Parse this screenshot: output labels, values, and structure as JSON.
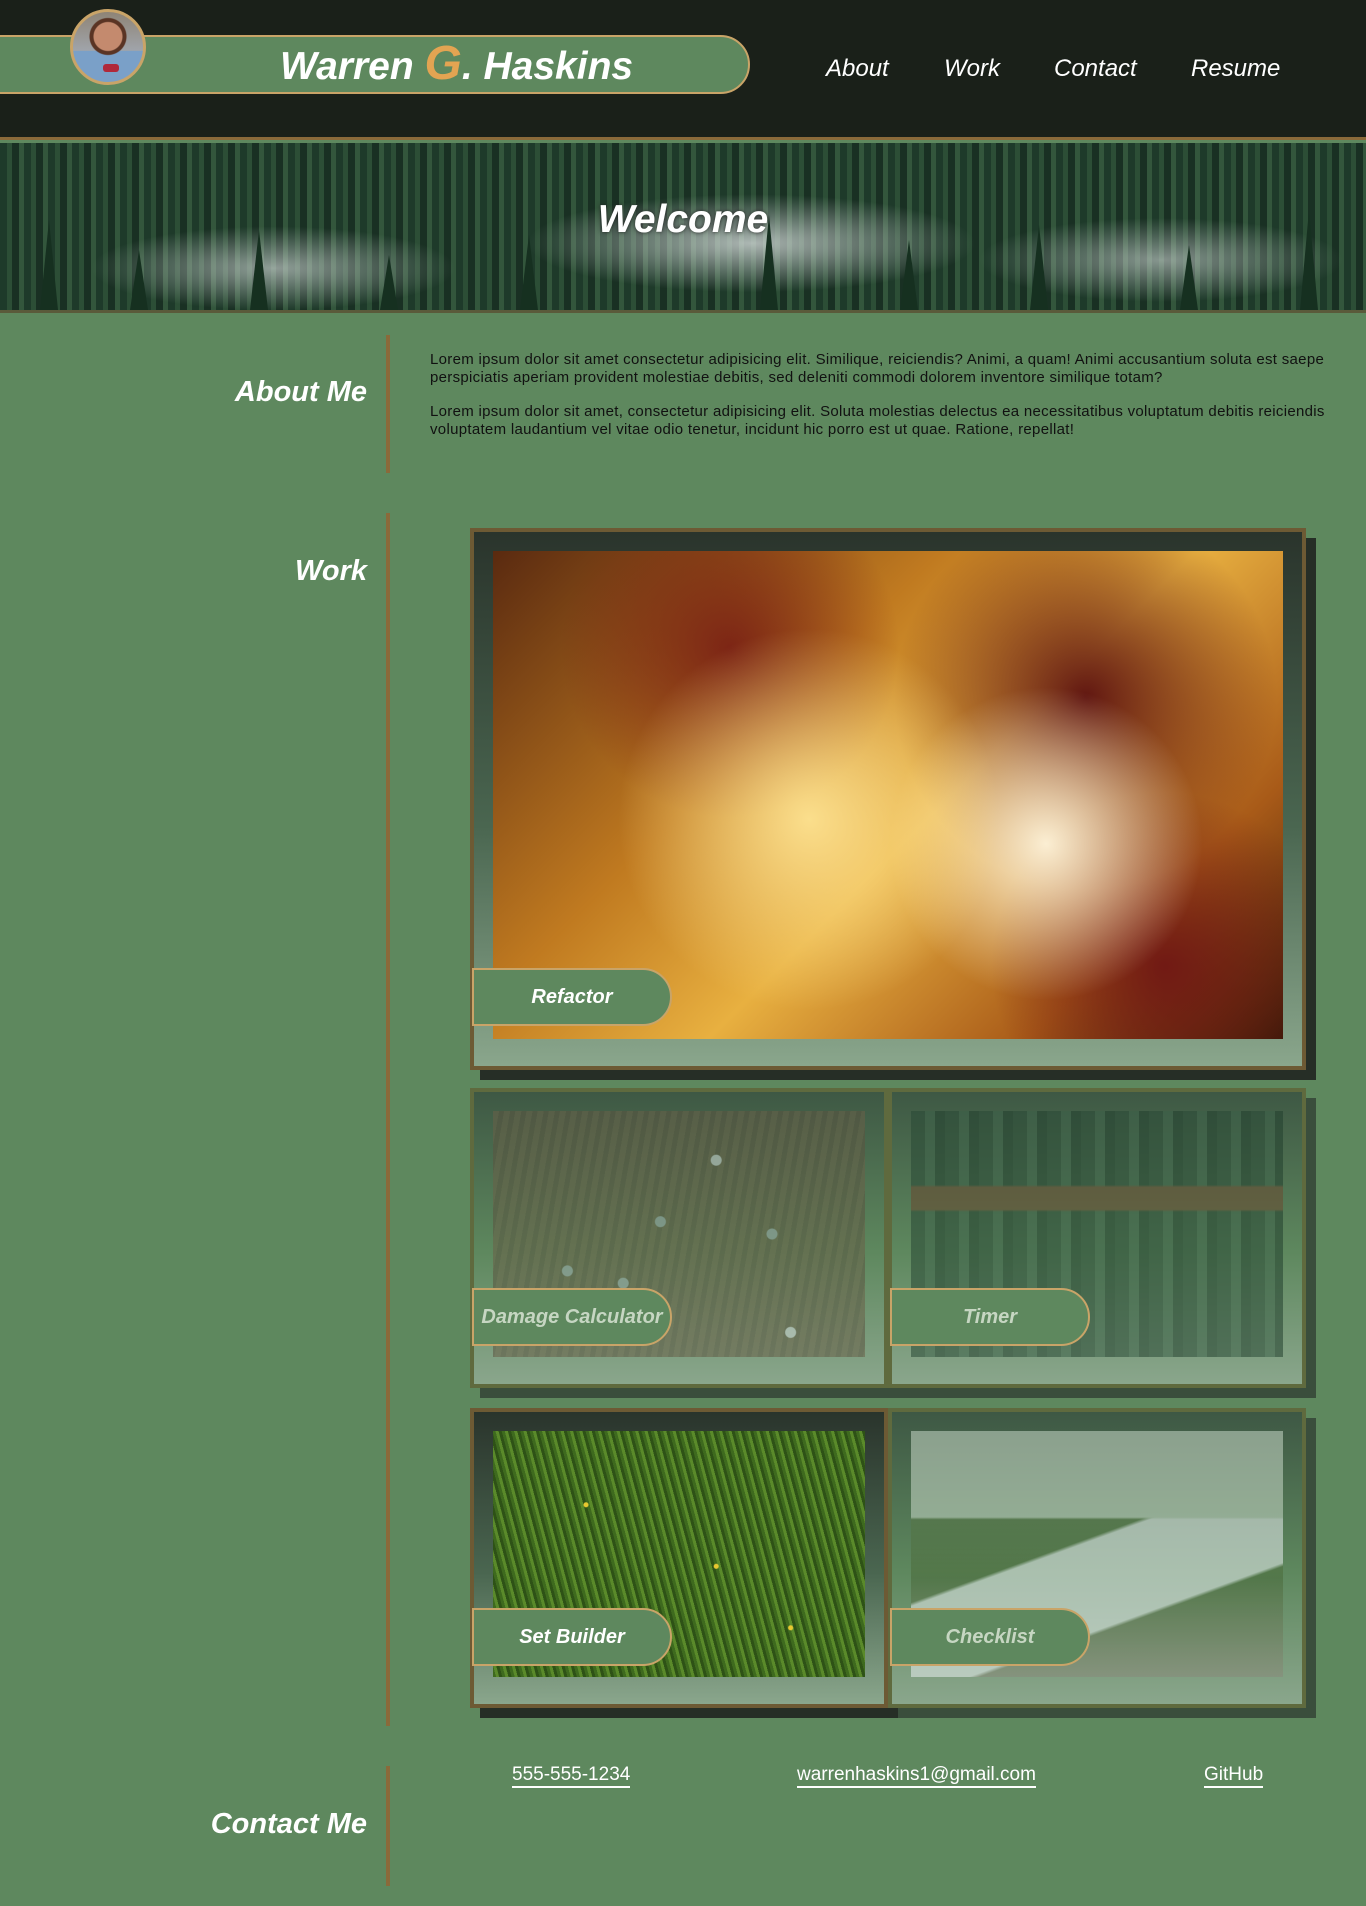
{
  "header": {
    "name_first": "Warren ",
    "name_initial": "G",
    "name_last": ". Haskins",
    "colors": {
      "background": "#1a2019",
      "accent": "#c9a468",
      "initial": "#e3a452"
    }
  },
  "nav": {
    "items": [
      {
        "label": "About"
      },
      {
        "label": "Work"
      },
      {
        "label": "Contact"
      },
      {
        "label": "Resume"
      }
    ]
  },
  "banner": {
    "title": "Welcome"
  },
  "about": {
    "title": "About Me",
    "paragraphs": [
      "Lorem ipsum dolor sit amet consectetur adipisicing elit. Similique, reiciendis? Animi, a quam! Animi accusantium soluta est saepe perspiciatis aperiam provident molestiae debitis, sed deleniti commodi dolorem inventore similique totam?",
      "Lorem ipsum dolor sit amet, consectetur adipisicing elit. Soluta molestias delectus ea necessitatibus voluptatum debitis reiciendis voluptatem laudantium vel vitae odio tenetur, incidunt hic porro est ut quae. Ratione, repellat!"
    ]
  },
  "work": {
    "title": "Work",
    "projects": [
      {
        "label": "Refactor"
      },
      {
        "label": "Damage Calculator"
      },
      {
        "label": "Timer"
      },
      {
        "label": "Set Builder"
      },
      {
        "label": "Checklist"
      }
    ]
  },
  "contact": {
    "title": "Contact Me",
    "phone": "555-555-1234",
    "email": "warrenhaskins1@gmail.com",
    "github": "GitHub"
  },
  "theme": {
    "page_background": "#5e885e",
    "border_brown": "#8a6a3a"
  }
}
